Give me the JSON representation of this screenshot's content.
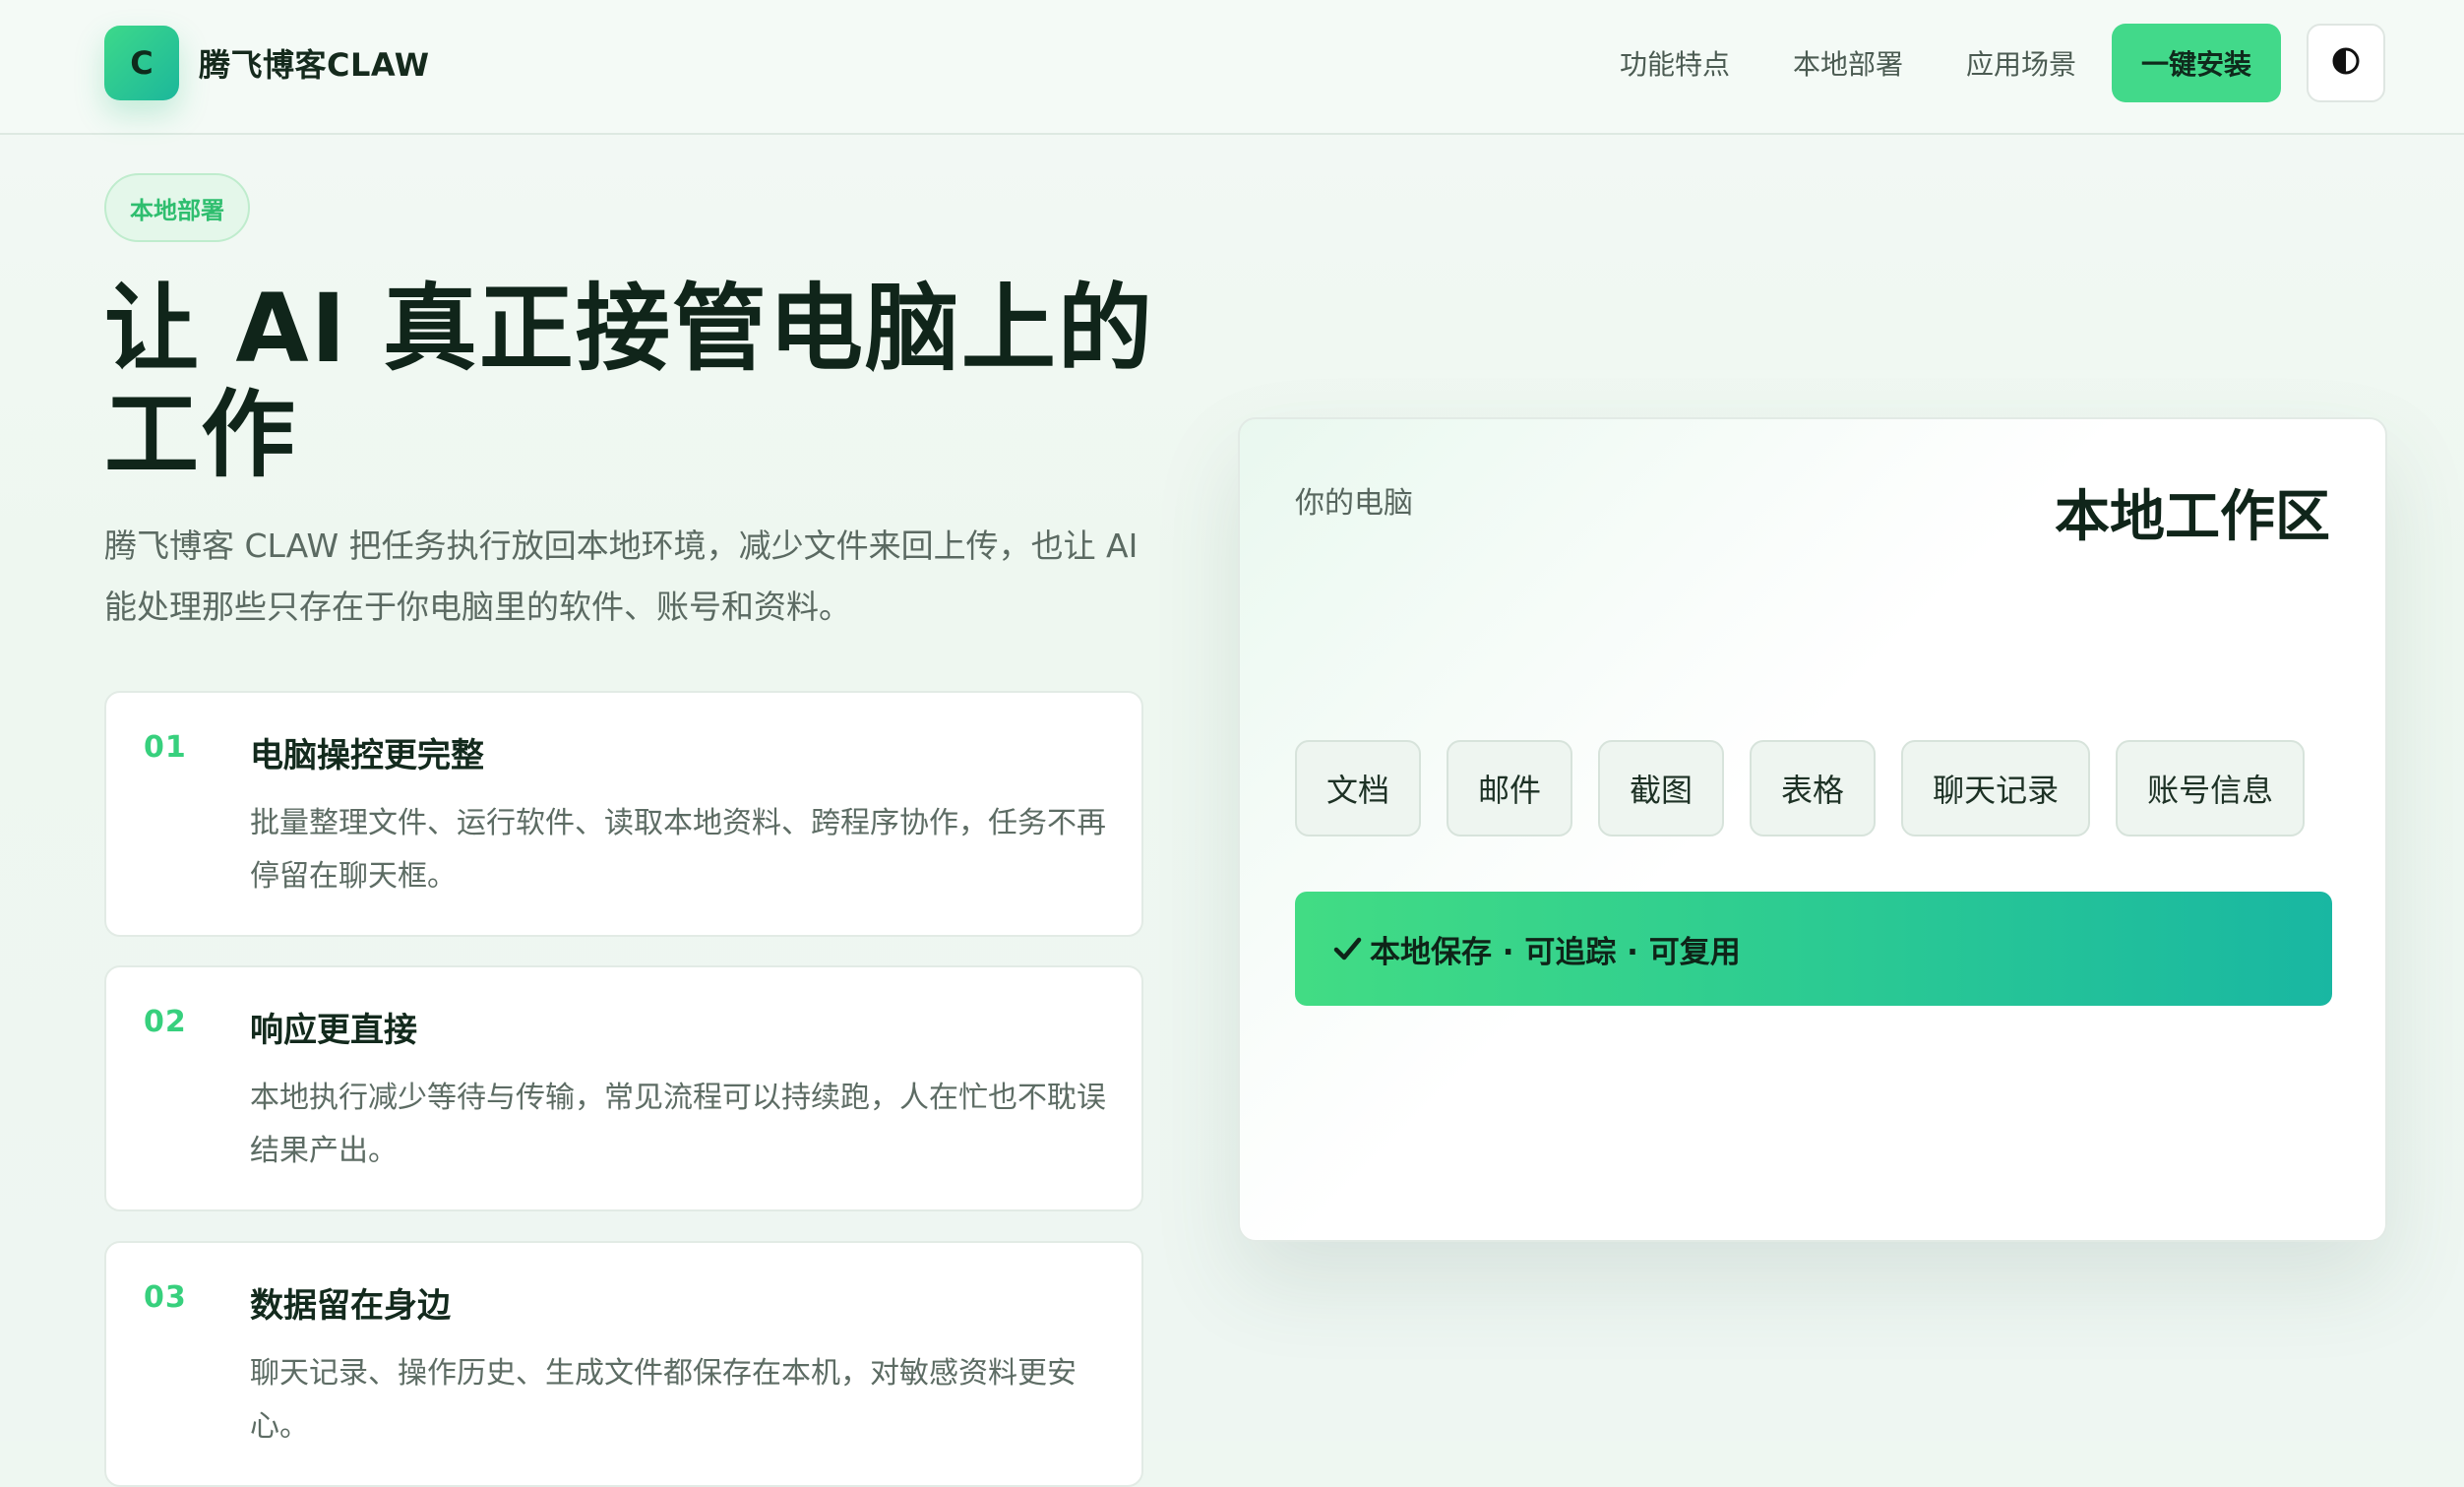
{
  "header": {
    "logo_letter": "C",
    "brand_name": "腾飞博客CLAW",
    "nav": [
      "功能特点",
      "本地部署",
      "应用场景"
    ],
    "install_label": "一键安装",
    "theme_icon": "contrast-icon"
  },
  "hero": {
    "badge": "本地部署",
    "title": "让 AI 真正接管电脑上的工作",
    "description": "腾飞博客 CLAW 把任务执行放回本地环境，减少文件来回上传，也让 AI 能处理那些只存在于你电脑里的软件、账号和资料。"
  },
  "features": [
    {
      "num": "01",
      "title": "电脑操控更完整",
      "desc": "批量整理文件、运行软件、读取本地资料、跨程序协作，任务不再停留在聊天框。"
    },
    {
      "num": "02",
      "title": "响应更直接",
      "desc": "本地执行减少等待与传输，常见流程可以持续跑，人在忙也不耽误结果产出。"
    },
    {
      "num": "03",
      "title": "数据留在身边",
      "desc": "聊天记录、操作历史、生成文件都保存在本机，对敏感资料更安心。"
    }
  ],
  "workspace": {
    "label": "你的电脑",
    "title": "本地工作区",
    "chips": [
      "文档",
      "邮件",
      "截图",
      "表格",
      "聊天记录",
      "账号信息"
    ],
    "status": "本地保存 · 可追踪 · 可复用",
    "status_icon": "check-icon"
  },
  "colors": {
    "accent": "#42d98a",
    "accent_dark": "#1cb79b",
    "text": "#15261c",
    "muted": "#5b6a62"
  }
}
